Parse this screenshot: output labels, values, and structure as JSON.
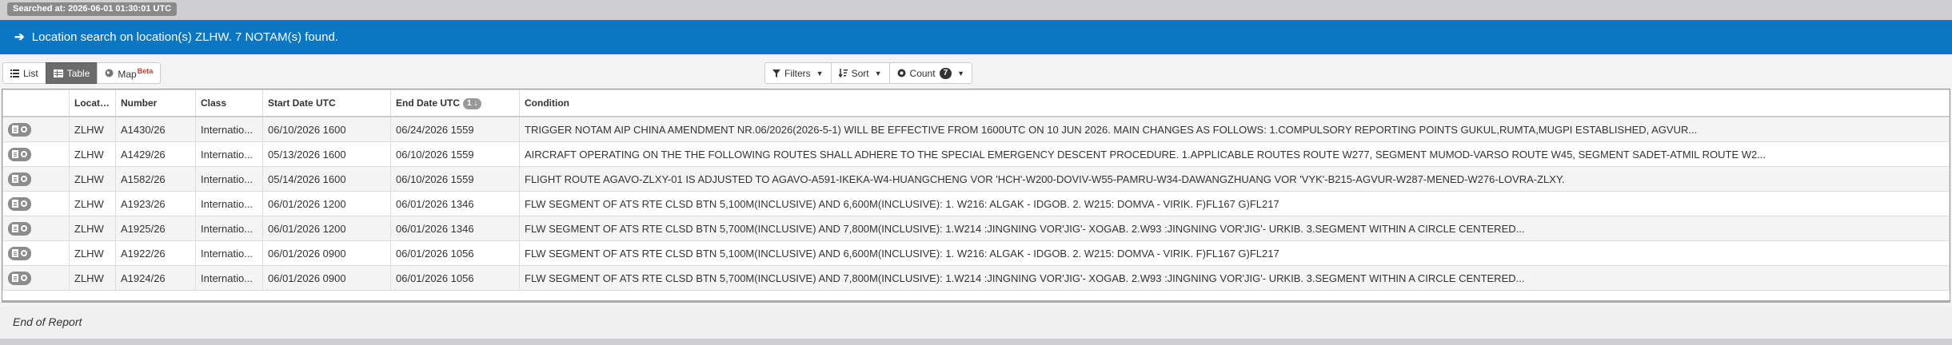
{
  "searched_at": "Searched at: 2026-06-01 01:30:01 UTC",
  "banner": {
    "arrow": "➔",
    "text": "Location search on location(s) ZLHW. 7 NOTAM(s) found."
  },
  "view_buttons": {
    "list": "List",
    "table": "Table",
    "map": "Map",
    "map_badge": "Beta"
  },
  "tools": {
    "filters": "Filters",
    "sort": "Sort",
    "count": "Count",
    "count_value": "7"
  },
  "table": {
    "headers": [
      "Location",
      "Number",
      "Class",
      "Start Date UTC",
      "End Date UTC",
      "Condition"
    ],
    "end_sort_badge": "1",
    "rows": [
      {
        "location": "ZLHW",
        "number": "A1430/26",
        "class": "Internatio...",
        "start": "06/10/2026 1600",
        "end": "06/24/2026 1559",
        "condition": "TRIGGER NOTAM AIP CHINA AMENDMENT NR.06/2026(2026-5-1) WILL BE EFFECTIVE FROM 1600UTC ON 10 JUN 2026. MAIN CHANGES AS FOLLOWS: 1.COMPULSORY REPORTING POINTS GUKUL,RUMTA,MUGPI ESTABLISHED, AGVUR..."
      },
      {
        "location": "ZLHW",
        "number": "A1429/26",
        "class": "Internatio...",
        "start": "05/13/2026 1600",
        "end": "06/10/2026 1559",
        "condition": "AIRCRAFT OPERATING ON THE THE FOLLOWING ROUTES SHALL ADHERE TO THE SPECIAL EMERGENCY DESCENT PROCEDURE. 1.APPLICABLE ROUTES ROUTE W277, SEGMENT MUMOD-VARSO ROUTE W45, SEGMENT SADET-ATMIL ROUTE W2..."
      },
      {
        "location": "ZLHW",
        "number": "A1582/26",
        "class": "Internatio...",
        "start": "05/14/2026 1600",
        "end": "06/10/2026 1559",
        "condition": "FLIGHT ROUTE AGAVO-ZLXY-01 IS ADJUSTED TO AGAVO-A591-IKEKA-W4-HUANGCHENG VOR 'HCH'-W200-DOVIV-W55-PAMRU-W34-DAWANGZHUANG VOR 'VYK'-B215-AGVUR-W287-MENED-W276-LOVRA-ZLXY."
      },
      {
        "location": "ZLHW",
        "number": "A1923/26",
        "class": "Internatio...",
        "start": "06/01/2026 1200",
        "end": "06/01/2026 1346",
        "condition": "FLW SEGMENT OF ATS RTE CLSD BTN 5,100M(INCLUSIVE) AND 6,600M(INCLUSIVE): 1. W216: ALGAK - IDGOB. 2. W215: DOMVA - VIRIK. F)FL167 G)FL217"
      },
      {
        "location": "ZLHW",
        "number": "A1925/26",
        "class": "Internatio...",
        "start": "06/01/2026 1200",
        "end": "06/01/2026 1346",
        "condition": "FLW SEGMENT OF ATS RTE CLSD BTN 5,700M(INCLUSIVE) AND 7,800M(INCLUSIVE): 1.W214 :JINGNING VOR'JIG'- XOGAB. 2.W93 :JINGNING VOR'JIG'- URKIB. 3.SEGMENT WITHIN A CIRCLE CENTERED..."
      },
      {
        "location": "ZLHW",
        "number": "A1922/26",
        "class": "Internatio...",
        "start": "06/01/2026 0900",
        "end": "06/01/2026 1056",
        "condition": "FLW SEGMENT OF ATS RTE CLSD BTN 5,100M(INCLUSIVE) AND 6,600M(INCLUSIVE): 1. W216: ALGAK - IDGOB. 2. W215: DOMVA - VIRIK. F)FL167 G)FL217"
      },
      {
        "location": "ZLHW",
        "number": "A1924/26",
        "class": "Internatio...",
        "start": "06/01/2026 0900",
        "end": "06/01/2026 1056",
        "condition": "FLW SEGMENT OF ATS RTE CLSD BTN 5,700M(INCLUSIVE) AND 7,800M(INCLUSIVE): 1.W214 :JINGNING VOR'JIG'- XOGAB. 2.W93 :JINGNING VOR'JIG'- URKIB. 3.SEGMENT WITHIN A CIRCLE CENTERED..."
      }
    ]
  },
  "end_of_report": "End of Report"
}
